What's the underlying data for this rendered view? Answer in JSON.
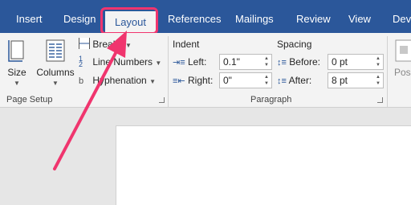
{
  "tabs": [
    {
      "label": "Insert"
    },
    {
      "label": "Design"
    },
    {
      "label": "Layout"
    },
    {
      "label": "References"
    },
    {
      "label": "Mailings"
    },
    {
      "label": "Review"
    },
    {
      "label": "View"
    },
    {
      "label": "Deve"
    }
  ],
  "page_setup": {
    "group_label": "Page Setup",
    "size_label": "Size",
    "columns_label": "Columns",
    "breaks_label": "Breaks",
    "line_numbers_label": "Line Numbers",
    "hyphenation_label": "Hyphenation"
  },
  "paragraph": {
    "group_label": "Paragraph",
    "indent_heading": "Indent",
    "left_label": "Left:",
    "left_value": "0.1\"",
    "right_label": "Right:",
    "right_value": "0\"",
    "spacing_heading": "Spacing",
    "before_label": "Before:",
    "before_value": "0 pt",
    "after_label": "After:",
    "after_value": "8 pt"
  },
  "position_label": "Posi",
  "colors": {
    "tab_bar": "#2b579a",
    "ribbon": "#f3f3f3",
    "highlight": "#f0356e",
    "doc_background": "#e6e6e6"
  }
}
